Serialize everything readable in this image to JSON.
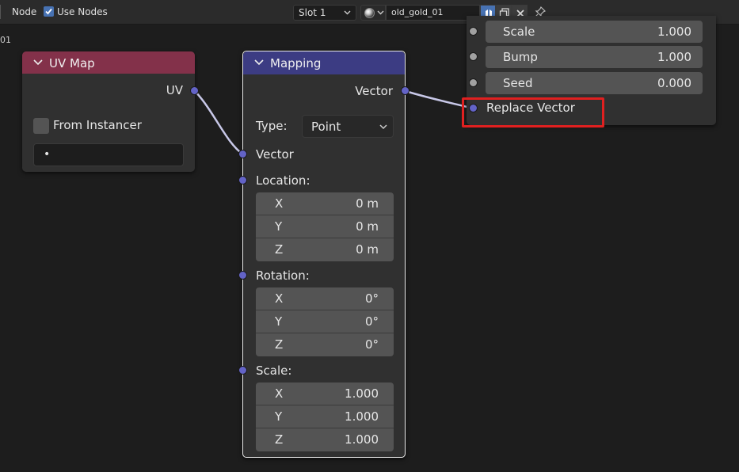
{
  "header": {
    "menu_node": "Node",
    "use_nodes_label": "Use Nodes",
    "use_nodes_checked": true,
    "slot": "Slot 1",
    "material_name": "old_gold_01"
  },
  "frame_number": "01",
  "uv_map_node": {
    "title": "UV Map",
    "output_uv": "UV",
    "from_instancer_label": "From Instancer",
    "uv_field_value": "•",
    "header_color": "#83314a"
  },
  "mapping_node": {
    "title": "Mapping",
    "header_color": "#3c3c83",
    "output_vector": "Vector",
    "type_label": "Type:",
    "type_value": "Point",
    "input_vector": "Vector",
    "location_label": "Location:",
    "location": [
      {
        "axis": "X",
        "value": "0 m"
      },
      {
        "axis": "Y",
        "value": "0 m"
      },
      {
        "axis": "Z",
        "value": "0 m"
      }
    ],
    "rotation_label": "Rotation:",
    "rotation": [
      {
        "axis": "X",
        "value": "0°"
      },
      {
        "axis": "Y",
        "value": "0°"
      },
      {
        "axis": "Z",
        "value": "0°"
      }
    ],
    "scale_label": "Scale:",
    "scale": [
      {
        "axis": "X",
        "value": "1.000"
      },
      {
        "axis": "Y",
        "value": "1.000"
      },
      {
        "axis": "Z",
        "value": "1.000"
      }
    ]
  },
  "right_node": {
    "fields": [
      {
        "label": "Scale",
        "value": "1.000"
      },
      {
        "label": "Bump",
        "value": "1.000"
      },
      {
        "label": "Seed",
        "value": "0.000"
      }
    ],
    "replace_vector_label": "Replace Vector"
  },
  "colors": {
    "socket_vector": "#6363c7",
    "socket_float": "#a1a1a1",
    "highlight_box": "#e02020",
    "link": "#c8c8e8"
  }
}
